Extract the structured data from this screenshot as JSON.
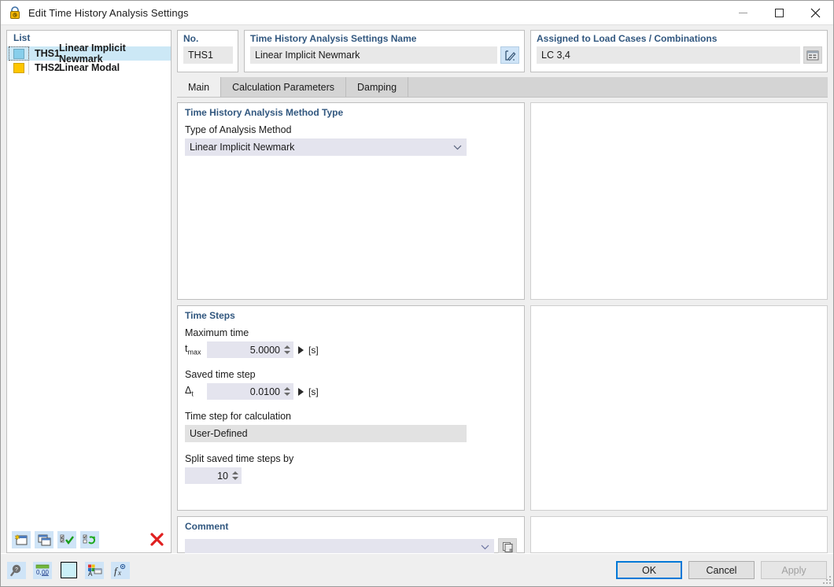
{
  "window": {
    "title": "Edit Time History Analysis Settings",
    "icon": "lock-clock-icon",
    "minimize_label": "Minimize",
    "maximize_label": "Maximize",
    "close_label": "Close"
  },
  "list_panel": {
    "header": "List",
    "rows": [
      {
        "no": "THS1",
        "label": "Linear Implicit Newmark",
        "color": "#87CEEB",
        "selected": true
      },
      {
        "no": "THS2",
        "label": "Linear Modal",
        "color": "#FFC600",
        "selected": false
      }
    ],
    "toolbar": [
      {
        "name": "new-entry-button",
        "icon": "new-window-icon"
      },
      {
        "name": "copy-entry-button",
        "icon": "copy-window-icon"
      },
      {
        "name": "select-all-button",
        "icon": "checklist-check-icon"
      },
      {
        "name": "invert-selection-button",
        "icon": "checklist-refresh-icon"
      },
      {
        "name": "delete-entry-button",
        "icon": "red-x-icon"
      }
    ]
  },
  "header_fields": {
    "no": {
      "label": "No.",
      "value": "THS1"
    },
    "name": {
      "label": "Time History Analysis Settings Name",
      "value": "Linear Implicit Newmark",
      "edit_icon": "pencil-edit-icon"
    },
    "assigned": {
      "label": "Assigned to Load Cases / Combinations",
      "value": "LC 3,4",
      "picker_icon": "table-select-icon"
    }
  },
  "tabs": [
    {
      "label": "Main",
      "active": true
    },
    {
      "label": "Calculation Parameters",
      "active": false
    },
    {
      "label": "Damping",
      "active": false
    }
  ],
  "method_group": {
    "title": "Time History Analysis Method Type",
    "field_label": "Type of Analysis Method",
    "selected": "Linear Implicit Newmark",
    "chevron_icon": "chevron-down-icon"
  },
  "time_steps_group": {
    "title": "Time Steps",
    "maximum_time": {
      "label": "Maximum time",
      "symbol": "t",
      "symbol_sub": "max",
      "value": "5.0000",
      "unit": "[s]"
    },
    "saved_time_step": {
      "label": "Saved time step",
      "symbol": "Δ",
      "symbol_sub": "t",
      "value": "0.0100",
      "unit": "[s]"
    },
    "time_step_for_calculation": {
      "label": "Time step for calculation",
      "value": "User-Defined"
    },
    "split_saved_time_steps": {
      "label": "Split saved time steps by",
      "value": "10"
    }
  },
  "comment_group": {
    "title": "Comment",
    "value": "",
    "chevron_icon": "chevron-down-icon",
    "copy_icon": "copy-pages-icon"
  },
  "bottom_toolbar": [
    {
      "name": "help-search-button",
      "icon": "magnifier-question-icon"
    },
    {
      "name": "units-button",
      "icon": "number-format-icon"
    },
    {
      "name": "color-swatch-button",
      "icon": "color-swatch-icon",
      "color": "#CBF0F8"
    },
    {
      "name": "display-properties-button",
      "icon": "palette-window-icon"
    },
    {
      "name": "function-button",
      "icon": "fx-icon"
    }
  ],
  "footer_buttons": {
    "ok": "OK",
    "cancel": "Cancel",
    "apply": "Apply",
    "apply_disabled": true
  },
  "colors": {
    "accent_blue": "#0078d7",
    "group_title": "#31577f",
    "selection": "#cce8f6",
    "field_bg": "#e4e4ee",
    "readonly_bg": "#e2e2e2"
  }
}
